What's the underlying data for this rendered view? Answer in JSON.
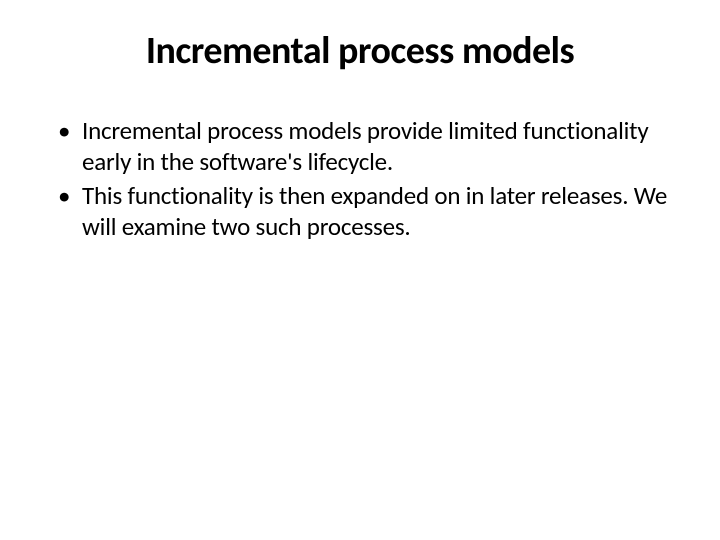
{
  "title": "Incremental process models",
  "bullets": [
    "Incremental process models provide limited functionality early in the software's lifecycle.",
    "This functionality is then expanded on in later releases. We will examine two such processes."
  ]
}
